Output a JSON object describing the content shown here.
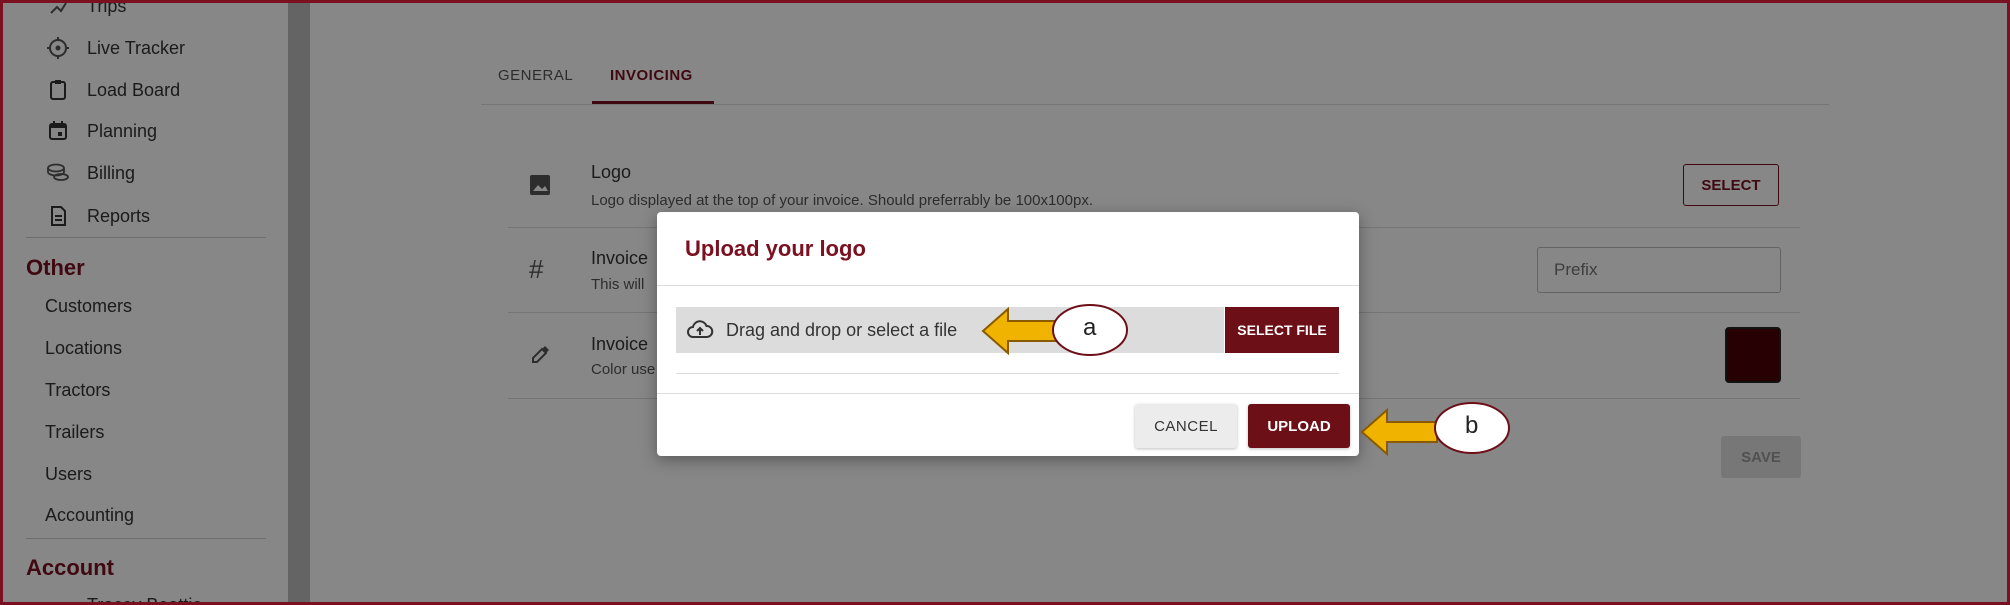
{
  "sidebar": {
    "nav": [
      {
        "label": "Trips",
        "icon": "trips-icon"
      },
      {
        "label": "Live Tracker",
        "icon": "crosshair-icon"
      },
      {
        "label": "Load Board",
        "icon": "clipboard-icon"
      },
      {
        "label": "Planning",
        "icon": "calendar-icon"
      },
      {
        "label": "Billing",
        "icon": "coins-icon"
      },
      {
        "label": "Reports",
        "icon": "report-icon"
      }
    ],
    "other_heading": "Other",
    "other_items": [
      "Customers",
      "Locations",
      "Tractors",
      "Trailers",
      "Users",
      "Accounting"
    ],
    "account_heading": "Account",
    "account_user": "Tracey Beattie"
  },
  "tabs": [
    {
      "label": "GENERAL"
    },
    {
      "label": "INVOICING"
    }
  ],
  "settings": {
    "logo": {
      "title": "Logo",
      "desc": "Logo displayed at the top of your invoice. Should preferrably be 100x100px.",
      "button": "SELECT"
    },
    "prefix": {
      "title": "Invoice",
      "desc": "This will",
      "placeholder": "Prefix"
    },
    "color": {
      "title": "Invoice",
      "desc": "Color use",
      "swatch": "#4a0008"
    },
    "save": "SAVE"
  },
  "dialog": {
    "title": "Upload your logo",
    "dropzone_text": "Drag and drop or select a file",
    "select_file": "SELECT FILE",
    "cancel": "CANCEL",
    "upload": "UPLOAD"
  },
  "annotations": {
    "a": "a",
    "b": "b"
  },
  "colors": {
    "accent": "#7a1020",
    "arrow_fill": "#f0b400",
    "arrow_stroke": "#8a5a00"
  }
}
